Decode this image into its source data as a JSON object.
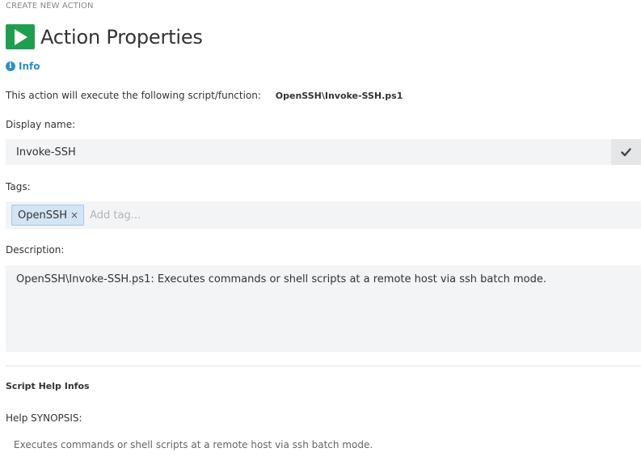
{
  "breadcrumb": "CREATE NEW ACTION",
  "header": {
    "title": "Action Properties",
    "icon": "play-icon",
    "icon_color": "#1e9e4f"
  },
  "info": {
    "label": "Info",
    "icon": "info-circle-icon",
    "color": "#2a8fd0"
  },
  "script": {
    "prefix": "This action will execute the following script/function:",
    "name": "OpenSSH\\Invoke-SSH.ps1"
  },
  "display_name": {
    "label": "Display name:",
    "value": "Invoke-SSH",
    "confirm_icon": "checkmark-icon"
  },
  "tags": {
    "label": "Tags:",
    "items": [
      {
        "label": "OpenSSH",
        "remove": "×"
      }
    ],
    "placeholder": "Add tag..."
  },
  "description": {
    "label": "Description:",
    "value": "OpenSSH\\Invoke-SSH.ps1: Executes commands or shell scripts at a remote host via ssh batch mode."
  },
  "help": {
    "heading": "Script Help Infos",
    "synopsis_label": "Help SYNOPSIS:",
    "synopsis_text": "Executes commands or shell scripts at a remote host via ssh batch mode."
  }
}
